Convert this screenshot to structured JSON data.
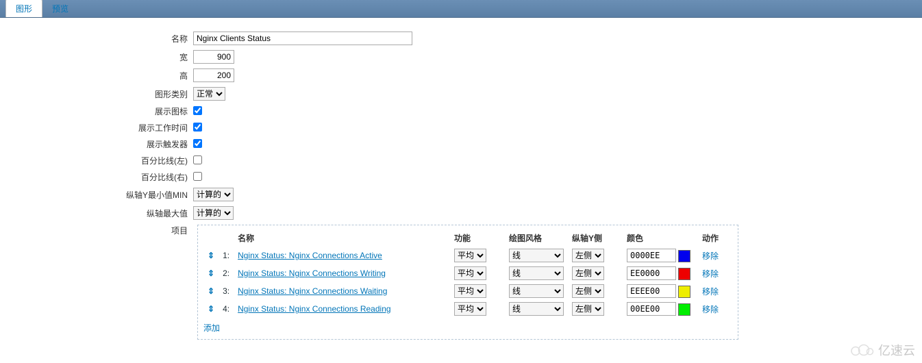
{
  "tabs": {
    "graph": "图形",
    "preview": "预览"
  },
  "labels": {
    "name": "名称",
    "width": "宽",
    "height": "高",
    "graphType": "图形类别",
    "showLegend": "展示图标",
    "showWorkTime": "展示工作时间",
    "showTriggers": "展示触发器",
    "percentLeft": "百分比线(左)",
    "percentRight": "百分比线(右)",
    "yMin": "纵轴Y最小值MIN",
    "yMax": "纵轴最大值",
    "items": "项目"
  },
  "values": {
    "name": "Nginx Clients Status",
    "width": "900",
    "height": "200",
    "graphType": "正常",
    "showLegend": true,
    "showWorkTime": true,
    "showTriggers": true,
    "percentLeft": false,
    "percentRight": false,
    "yMin": "计算的",
    "yMax": "计算的"
  },
  "itemsTable": {
    "headers": {
      "name": "名称",
      "func": "功能",
      "drawStyle": "绘图风格",
      "yAxis": "纵轴Y侧",
      "color": "颜色",
      "action": "动作"
    },
    "funcOption": "平均",
    "styleOption": "线",
    "sideOption": "左侧",
    "removeLabel": "移除",
    "addLabel": "添加",
    "rows": [
      {
        "idx": "1:",
        "name": "Nginx Status: Nginx Connections Active",
        "color": "0000EE",
        "swatch": "#0000EE"
      },
      {
        "idx": "2:",
        "name": "Nginx Status: Nginx Connections Writing",
        "color": "EE0000",
        "swatch": "#EE0000"
      },
      {
        "idx": "3:",
        "name": "Nginx Status: Nginx Connections Waiting",
        "color": "EEEE00",
        "swatch": "#EEEE00"
      },
      {
        "idx": "4:",
        "name": "Nginx Status: Nginx Connections Reading",
        "color": "00EE00",
        "swatch": "#00EE00"
      }
    ]
  },
  "watermark": "亿速云"
}
